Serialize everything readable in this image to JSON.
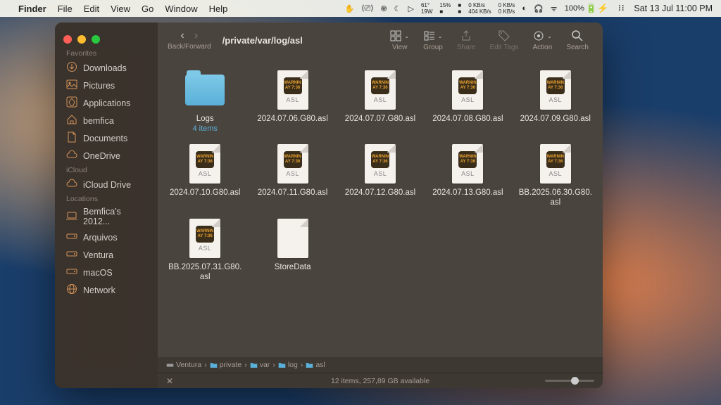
{
  "menubar": {
    "app": "Finder",
    "menus": [
      "File",
      "Edit",
      "View",
      "Go",
      "Window",
      "Help"
    ],
    "temp_f": "61°",
    "temp_c": "19W",
    "cpu": "15%",
    "gpu": "C G",
    "ram": "R A M",
    "net": "R W",
    "net_up": "0 KB/s",
    "net_down": "404 KB/s",
    "disk_up": "0 KB/s",
    "disk_down": "0 KB/s",
    "battery": "100%",
    "clock": "Sat 13 Jul  11:00 PM"
  },
  "sidebar": {
    "sections": [
      {
        "title": "Favorites",
        "items": [
          {
            "icon": "download",
            "label": "Downloads"
          },
          {
            "icon": "picture",
            "label": "Pictures"
          },
          {
            "icon": "apps",
            "label": "Applications"
          },
          {
            "icon": "home",
            "label": "bemfica"
          },
          {
            "icon": "doc",
            "label": "Documents"
          },
          {
            "icon": "cloud",
            "label": "OneDrive"
          }
        ]
      },
      {
        "title": "iCloud",
        "items": [
          {
            "icon": "cloud",
            "label": "iCloud Drive"
          }
        ]
      },
      {
        "title": "Locations",
        "items": [
          {
            "icon": "laptop",
            "label": "Bemfica's 2012..."
          },
          {
            "icon": "disk",
            "label": "Arquivos"
          },
          {
            "icon": "disk",
            "label": "Ventura"
          },
          {
            "icon": "disk",
            "label": "macOS"
          },
          {
            "icon": "globe",
            "label": "Network"
          }
        ]
      }
    ]
  },
  "toolbar": {
    "nav_label": "Back/Forward",
    "path": "/private/var/log/asl",
    "view_label": "View",
    "group_label": "Group",
    "share_label": "Share",
    "tags_label": "Edit Tags",
    "action_label": "Action",
    "search_label": "Search"
  },
  "files": [
    {
      "type": "folder",
      "name": "Logs",
      "sub": "4 items"
    },
    {
      "type": "asl",
      "name": "2024.07.06.G80.asl"
    },
    {
      "type": "asl",
      "name": "2024.07.07.G80.asl"
    },
    {
      "type": "asl",
      "name": "2024.07.08.G80.asl"
    },
    {
      "type": "asl",
      "name": "2024.07.09.G80.asl"
    },
    {
      "type": "asl",
      "name": "2024.07.10.G80.asl"
    },
    {
      "type": "asl",
      "name": "2024.07.11.G80.asl"
    },
    {
      "type": "asl",
      "name": "2024.07.12.G80.asl"
    },
    {
      "type": "asl",
      "name": "2024.07.13.G80.asl"
    },
    {
      "type": "asl",
      "name": "BB.2025.06.30.G80.asl"
    },
    {
      "type": "asl",
      "name": "BB.2025.07.31.G80.asl"
    },
    {
      "type": "blank",
      "name": "StoreData"
    }
  ],
  "pathbar": [
    "Ventura",
    "private",
    "var",
    "log",
    "asl"
  ],
  "statusbar": {
    "info": "12 items, 257,89 GB available"
  },
  "asl_icon": {
    "l1": "WARNIN",
    "l2": "AY 7:36",
    "ext": "ASL"
  }
}
